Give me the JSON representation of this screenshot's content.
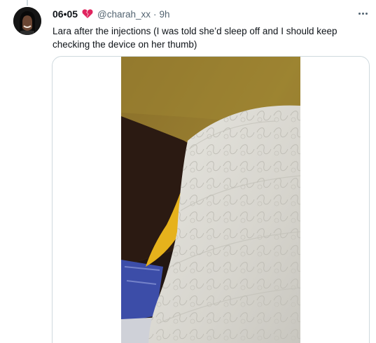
{
  "tweet": {
    "display_name": "06•05",
    "name_emoji_icon": "broken-heart-icon",
    "handle": "@charah_xx",
    "separator": "·",
    "time": "9h",
    "text": "Lara after the injections (I was told she’d sleep off and I should keep checking the device on her thumb)",
    "more_icon": "more-horizontal-icon"
  },
  "media": {
    "type": "video"
  },
  "colors": {
    "text_primary": "#0f1419",
    "text_secondary": "#536471",
    "border": "#cfd9de",
    "broken_heart": "#e0245e"
  }
}
